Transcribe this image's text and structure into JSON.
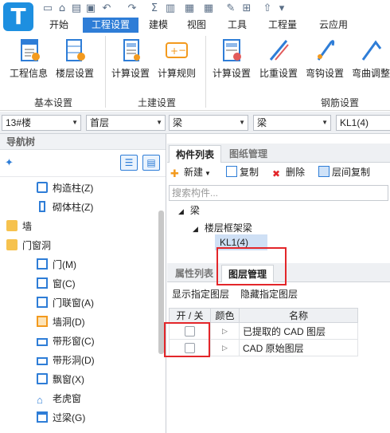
{
  "app": {
    "logo_letter": "T"
  },
  "quick_access": [
    "save-icon",
    "open-icon",
    "folder-icon",
    "floppy-icon",
    "undo-icon",
    "redo-icon",
    "sigma-icon",
    "tick-icon",
    "table-icon",
    "pencil-icon",
    "grid-icon",
    "pin-icon",
    "dropdown-icon"
  ],
  "ribbon": {
    "tabs": [
      "开始",
      "工程设置",
      "建模",
      "视图",
      "工具",
      "工程量",
      "云应用"
    ],
    "active_tab": "工程设置",
    "groups": [
      {
        "label": "基本设置",
        "buttons": [
          "工程信息",
          "楼层设置"
        ]
      },
      {
        "label": "土建设置",
        "buttons": [
          "计算设置",
          "计算规则"
        ]
      },
      {
        "label": "钢筋设置",
        "buttons": [
          "计算设置",
          "比重设置",
          "弯钩设置",
          "弯曲调整"
        ]
      }
    ]
  },
  "selectors": [
    "13#楼",
    "首层",
    "梁",
    "梁",
    "KL1(4)"
  ],
  "nav": {
    "header": "导航树",
    "items": [
      {
        "label": "构造柱(Z)",
        "icon": "construction-column-icon"
      },
      {
        "label": "砌体柱(Z)",
        "icon": "masonry-column-icon"
      },
      {
        "label": "墙",
        "icon": "folder-icon"
      },
      {
        "label": "门窗洞",
        "icon": "folder-open-icon"
      },
      {
        "label": "门(M)",
        "icon": "door-icon"
      },
      {
        "label": "窗(C)",
        "icon": "window-icon"
      },
      {
        "label": "门联窗(A)",
        "icon": "door-window-icon"
      },
      {
        "label": "墙洞(D)",
        "icon": "wall-opening-icon"
      },
      {
        "label": "带形窗(C)",
        "icon": "strip-window-icon"
      },
      {
        "label": "带形洞(D)",
        "icon": "strip-opening-icon"
      },
      {
        "label": "飘窗(X)",
        "icon": "bay-window-icon"
      },
      {
        "label": "老虎窗",
        "icon": "dormer-icon"
      },
      {
        "label": "过梁(G)",
        "icon": "lintel-icon"
      }
    ]
  },
  "component_panel": {
    "tabs": [
      "构件列表",
      "图纸管理"
    ],
    "toolbar": {
      "new": "新建",
      "copy": "复制",
      "delete": "删除",
      "floor_copy": "层间复制"
    },
    "search_placeholder": "搜索构件...",
    "tree": {
      "root": "梁",
      "child": "楼层框架梁",
      "leaf": "KL1(4)"
    }
  },
  "layer_panel": {
    "tabs": [
      "属性列表",
      "图层管理"
    ],
    "show_layers": "显示指定图层",
    "hide_layers": "隐藏指定图层",
    "columns": [
      "开 / 关",
      "颜色",
      "名称"
    ],
    "rows": [
      {
        "name": "已提取的 CAD 图层",
        "checked": false
      },
      {
        "name": "CAD 原始图层",
        "checked": false
      }
    ]
  },
  "colors": {
    "accent": "#2e7dd7",
    "logo": "#1d8fe0",
    "highlight_box": "#e3262a"
  }
}
